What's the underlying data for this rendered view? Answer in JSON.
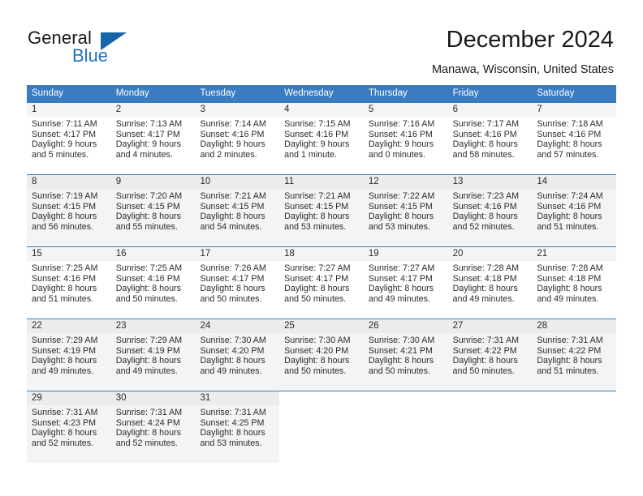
{
  "brand": {
    "word_one": "General",
    "word_two": "Blue",
    "triangle_color": "#1565a8",
    "blue_text_color": "#1f72bd"
  },
  "header": {
    "title": "December 2024",
    "location": "Manawa, Wisconsin, United States"
  },
  "theme": {
    "header_blue": "#3a7cbf",
    "row_separator": "#3a7cbf",
    "shaded_row": "#f4f4f4",
    "daynum_band": "#f4f4f4",
    "text": "#2b2b2b"
  },
  "weekday_headers": [
    "Sunday",
    "Monday",
    "Tuesday",
    "Wednesday",
    "Thursday",
    "Friday",
    "Saturday"
  ],
  "labels": {
    "sunrise_prefix": "Sunrise:",
    "sunset_prefix": "Sunset:",
    "daylight_prefix": "Daylight:"
  },
  "weeks": [
    {
      "shaded": false,
      "days": [
        {
          "num": "1",
          "sunrise": "Sunrise: 7:11 AM",
          "sunset": "Sunset: 4:17 PM",
          "daylight_line1": "Daylight: 9 hours",
          "daylight_line2": "and 5 minutes."
        },
        {
          "num": "2",
          "sunrise": "Sunrise: 7:13 AM",
          "sunset": "Sunset: 4:17 PM",
          "daylight_line1": "Daylight: 9 hours",
          "daylight_line2": "and 4 minutes."
        },
        {
          "num": "3",
          "sunrise": "Sunrise: 7:14 AM",
          "sunset": "Sunset: 4:16 PM",
          "daylight_line1": "Daylight: 9 hours",
          "daylight_line2": "and 2 minutes."
        },
        {
          "num": "4",
          "sunrise": "Sunrise: 7:15 AM",
          "sunset": "Sunset: 4:16 PM",
          "daylight_line1": "Daylight: 9 hours",
          "daylight_line2": "and 1 minute."
        },
        {
          "num": "5",
          "sunrise": "Sunrise: 7:16 AM",
          "sunset": "Sunset: 4:16 PM",
          "daylight_line1": "Daylight: 9 hours",
          "daylight_line2": "and 0 minutes."
        },
        {
          "num": "6",
          "sunrise": "Sunrise: 7:17 AM",
          "sunset": "Sunset: 4:16 PM",
          "daylight_line1": "Daylight: 8 hours",
          "daylight_line2": "and 58 minutes."
        },
        {
          "num": "7",
          "sunrise": "Sunrise: 7:18 AM",
          "sunset": "Sunset: 4:16 PM",
          "daylight_line1": "Daylight: 8 hours",
          "daylight_line2": "and 57 minutes."
        }
      ]
    },
    {
      "shaded": true,
      "days": [
        {
          "num": "8",
          "sunrise": "Sunrise: 7:19 AM",
          "sunset": "Sunset: 4:15 PM",
          "daylight_line1": "Daylight: 8 hours",
          "daylight_line2": "and 56 minutes."
        },
        {
          "num": "9",
          "sunrise": "Sunrise: 7:20 AM",
          "sunset": "Sunset: 4:15 PM",
          "daylight_line1": "Daylight: 8 hours",
          "daylight_line2": "and 55 minutes."
        },
        {
          "num": "10",
          "sunrise": "Sunrise: 7:21 AM",
          "sunset": "Sunset: 4:15 PM",
          "daylight_line1": "Daylight: 8 hours",
          "daylight_line2": "and 54 minutes."
        },
        {
          "num": "11",
          "sunrise": "Sunrise: 7:21 AM",
          "sunset": "Sunset: 4:15 PM",
          "daylight_line1": "Daylight: 8 hours",
          "daylight_line2": "and 53 minutes."
        },
        {
          "num": "12",
          "sunrise": "Sunrise: 7:22 AM",
          "sunset": "Sunset: 4:15 PM",
          "daylight_line1": "Daylight: 8 hours",
          "daylight_line2": "and 53 minutes."
        },
        {
          "num": "13",
          "sunrise": "Sunrise: 7:23 AM",
          "sunset": "Sunset: 4:16 PM",
          "daylight_line1": "Daylight: 8 hours",
          "daylight_line2": "and 52 minutes."
        },
        {
          "num": "14",
          "sunrise": "Sunrise: 7:24 AM",
          "sunset": "Sunset: 4:16 PM",
          "daylight_line1": "Daylight: 8 hours",
          "daylight_line2": "and 51 minutes."
        }
      ]
    },
    {
      "shaded": false,
      "days": [
        {
          "num": "15",
          "sunrise": "Sunrise: 7:25 AM",
          "sunset": "Sunset: 4:16 PM",
          "daylight_line1": "Daylight: 8 hours",
          "daylight_line2": "and 51 minutes."
        },
        {
          "num": "16",
          "sunrise": "Sunrise: 7:25 AM",
          "sunset": "Sunset: 4:16 PM",
          "daylight_line1": "Daylight: 8 hours",
          "daylight_line2": "and 50 minutes."
        },
        {
          "num": "17",
          "sunrise": "Sunrise: 7:26 AM",
          "sunset": "Sunset: 4:17 PM",
          "daylight_line1": "Daylight: 8 hours",
          "daylight_line2": "and 50 minutes."
        },
        {
          "num": "18",
          "sunrise": "Sunrise: 7:27 AM",
          "sunset": "Sunset: 4:17 PM",
          "daylight_line1": "Daylight: 8 hours",
          "daylight_line2": "and 50 minutes."
        },
        {
          "num": "19",
          "sunrise": "Sunrise: 7:27 AM",
          "sunset": "Sunset: 4:17 PM",
          "daylight_line1": "Daylight: 8 hours",
          "daylight_line2": "and 49 minutes."
        },
        {
          "num": "20",
          "sunrise": "Sunrise: 7:28 AM",
          "sunset": "Sunset: 4:18 PM",
          "daylight_line1": "Daylight: 8 hours",
          "daylight_line2": "and 49 minutes."
        },
        {
          "num": "21",
          "sunrise": "Sunrise: 7:28 AM",
          "sunset": "Sunset: 4:18 PM",
          "daylight_line1": "Daylight: 8 hours",
          "daylight_line2": "and 49 minutes."
        }
      ]
    },
    {
      "shaded": true,
      "days": [
        {
          "num": "22",
          "sunrise": "Sunrise: 7:29 AM",
          "sunset": "Sunset: 4:19 PM",
          "daylight_line1": "Daylight: 8 hours",
          "daylight_line2": "and 49 minutes."
        },
        {
          "num": "23",
          "sunrise": "Sunrise: 7:29 AM",
          "sunset": "Sunset: 4:19 PM",
          "daylight_line1": "Daylight: 8 hours",
          "daylight_line2": "and 49 minutes."
        },
        {
          "num": "24",
          "sunrise": "Sunrise: 7:30 AM",
          "sunset": "Sunset: 4:20 PM",
          "daylight_line1": "Daylight: 8 hours",
          "daylight_line2": "and 49 minutes."
        },
        {
          "num": "25",
          "sunrise": "Sunrise: 7:30 AM",
          "sunset": "Sunset: 4:20 PM",
          "daylight_line1": "Daylight: 8 hours",
          "daylight_line2": "and 50 minutes."
        },
        {
          "num": "26",
          "sunrise": "Sunrise: 7:30 AM",
          "sunset": "Sunset: 4:21 PM",
          "daylight_line1": "Daylight: 8 hours",
          "daylight_line2": "and 50 minutes."
        },
        {
          "num": "27",
          "sunrise": "Sunrise: 7:31 AM",
          "sunset": "Sunset: 4:22 PM",
          "daylight_line1": "Daylight: 8 hours",
          "daylight_line2": "and 50 minutes."
        },
        {
          "num": "28",
          "sunrise": "Sunrise: 7:31 AM",
          "sunset": "Sunset: 4:22 PM",
          "daylight_line1": "Daylight: 8 hours",
          "daylight_line2": "and 51 minutes."
        }
      ]
    },
    {
      "shaded": true,
      "days": [
        {
          "num": "29",
          "sunrise": "Sunrise: 7:31 AM",
          "sunset": "Sunset: 4:23 PM",
          "daylight_line1": "Daylight: 8 hours",
          "daylight_line2": "and 52 minutes."
        },
        {
          "num": "30",
          "sunrise": "Sunrise: 7:31 AM",
          "sunset": "Sunset: 4:24 PM",
          "daylight_line1": "Daylight: 8 hours",
          "daylight_line2": "and 52 minutes."
        },
        {
          "num": "31",
          "sunrise": "Sunrise: 7:31 AM",
          "sunset": "Sunset: 4:25 PM",
          "daylight_line1": "Daylight: 8 hours",
          "daylight_line2": "and 53 minutes."
        },
        {
          "num": "",
          "sunrise": "",
          "sunset": "",
          "daylight_line1": "",
          "daylight_line2": ""
        },
        {
          "num": "",
          "sunrise": "",
          "sunset": "",
          "daylight_line1": "",
          "daylight_line2": ""
        },
        {
          "num": "",
          "sunrise": "",
          "sunset": "",
          "daylight_line1": "",
          "daylight_line2": ""
        },
        {
          "num": "",
          "sunrise": "",
          "sunset": "",
          "daylight_line1": "",
          "daylight_line2": ""
        }
      ]
    }
  ]
}
